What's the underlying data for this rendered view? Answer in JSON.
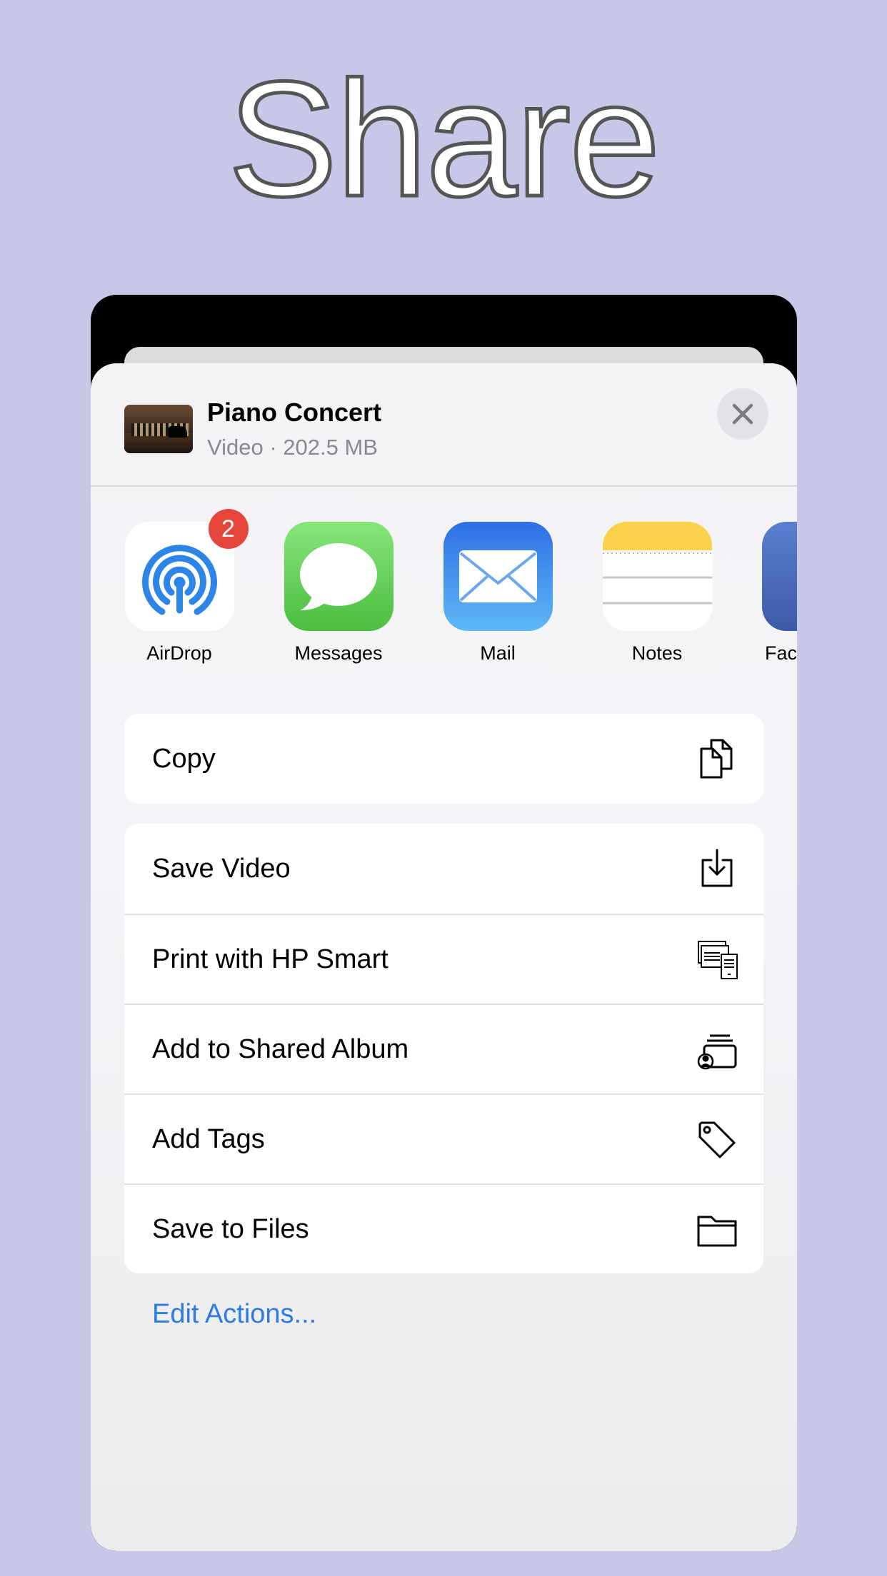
{
  "banner": {
    "title": "Share"
  },
  "share_sheet": {
    "file": {
      "title": "Piano Concert",
      "subtitle": "Video · 202.5 MB"
    },
    "apps": [
      {
        "name": "AirDrop",
        "icon": "airdrop-icon",
        "badge": "2"
      },
      {
        "name": "Messages",
        "icon": "messages-icon"
      },
      {
        "name": "Mail",
        "icon": "mail-icon"
      },
      {
        "name": "Notes",
        "icon": "notes-icon"
      },
      {
        "name": "Fac",
        "icon": "facebook-icon"
      }
    ],
    "primary_actions": [
      {
        "label": "Copy",
        "icon": "copy-icon"
      }
    ],
    "actions": [
      {
        "label": "Save Video",
        "icon": "save-download-icon"
      },
      {
        "label": "Print with HP Smart",
        "icon": "print-icon"
      },
      {
        "label": "Add to Shared Album",
        "icon": "shared-album-icon"
      },
      {
        "label": "Add Tags",
        "icon": "tag-icon"
      },
      {
        "label": "Save to Files",
        "icon": "folder-icon"
      }
    ],
    "edit_actions_label": "Edit Actions..."
  },
  "colors": {
    "background": "#c7c7e8",
    "link_blue": "#2f7ae5",
    "badge_red": "#e5463c"
  }
}
